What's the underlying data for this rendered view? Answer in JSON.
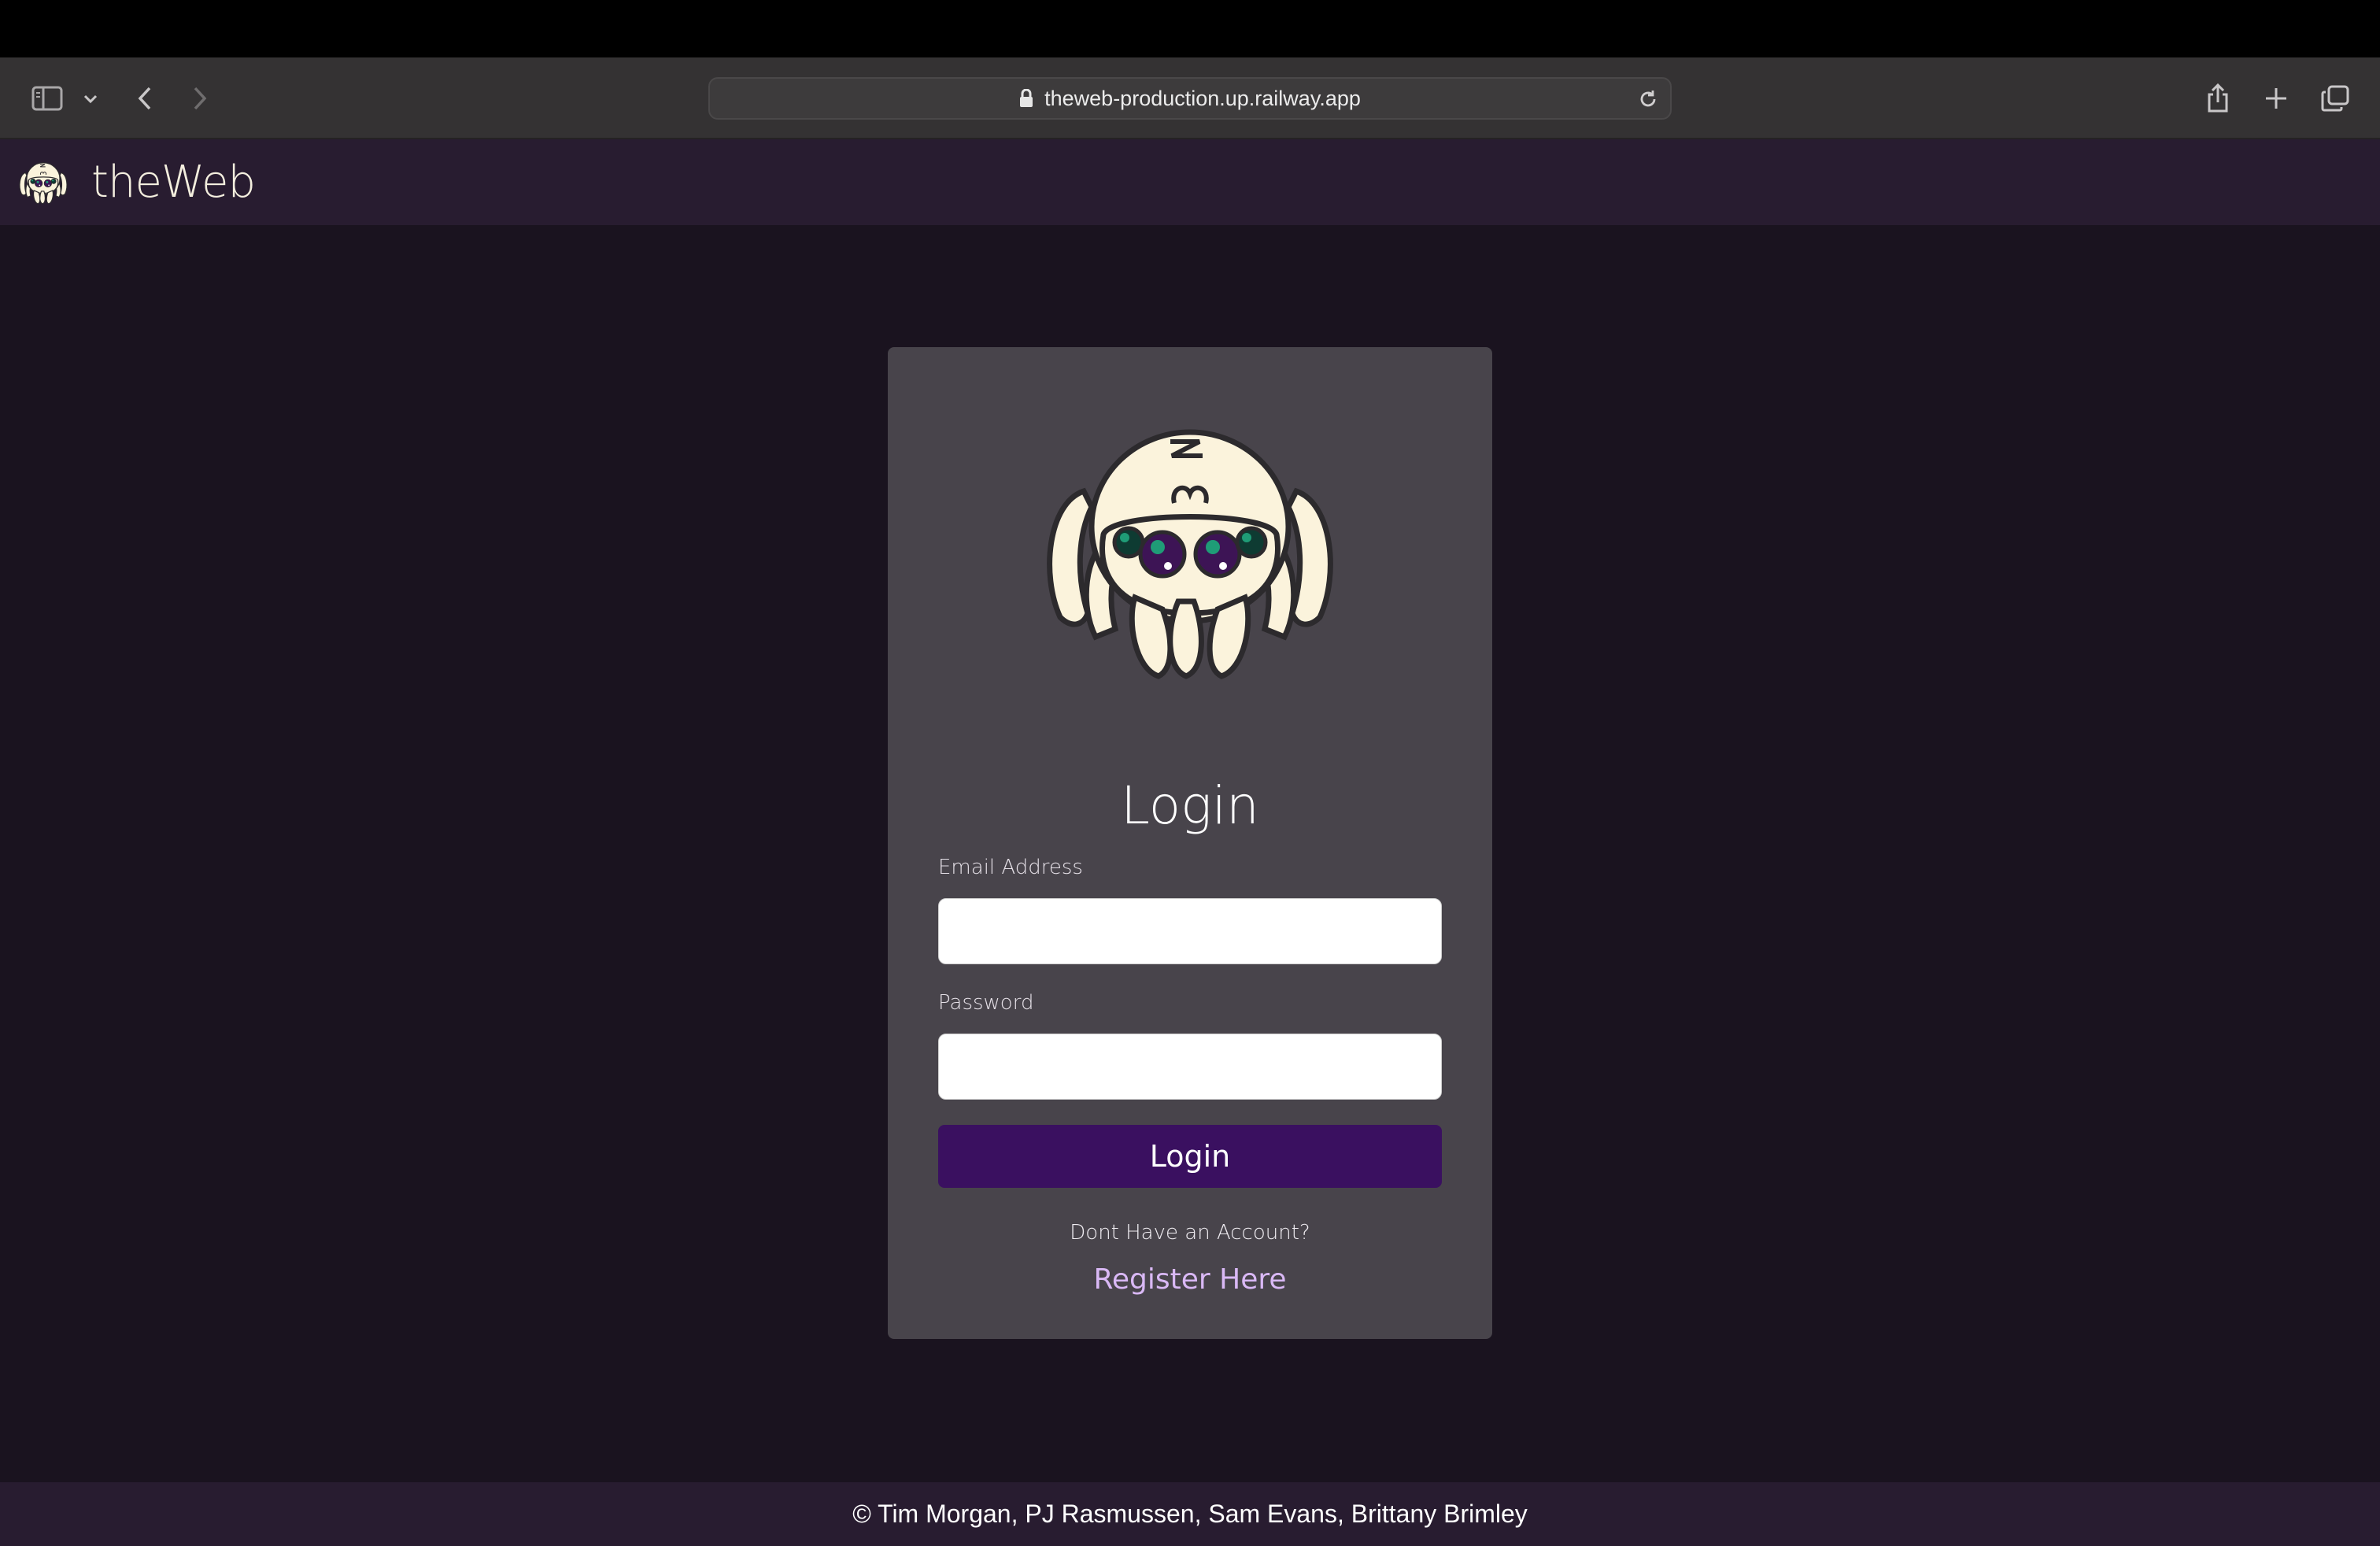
{
  "browser": {
    "url": "theweb-production.up.railway.app",
    "icons": {
      "sidebar": "sidebar-icon",
      "sidebar_menu": "chevron-down-icon",
      "back": "chevron-left-icon",
      "forward": "chevron-right-icon",
      "lock": "lock-icon",
      "reload": "reload-icon",
      "share": "share-icon",
      "new_tab": "plus-icon",
      "tabs": "tabs-overview-icon"
    }
  },
  "navbar": {
    "brand_name": "theWeb",
    "logo": "spider-logo-icon"
  },
  "login": {
    "title": "Login",
    "email_label": "Email Address",
    "email_value": "",
    "password_label": "Password",
    "password_value": "",
    "submit_label": "Login",
    "no_account_text": "Dont Have an Account?",
    "register_link": "Register Here"
  },
  "footer": {
    "copyright": "© Tim Morgan, PJ Rasmussen, Sam Evans, Brittany Brimley"
  },
  "colors": {
    "page_background": "#1a131f",
    "navbar_background": "#281c30",
    "card_background": "#48444b",
    "button_background": "#3a1060",
    "link": "#d9b8f5",
    "logo_fill": "#fbf3dc"
  }
}
